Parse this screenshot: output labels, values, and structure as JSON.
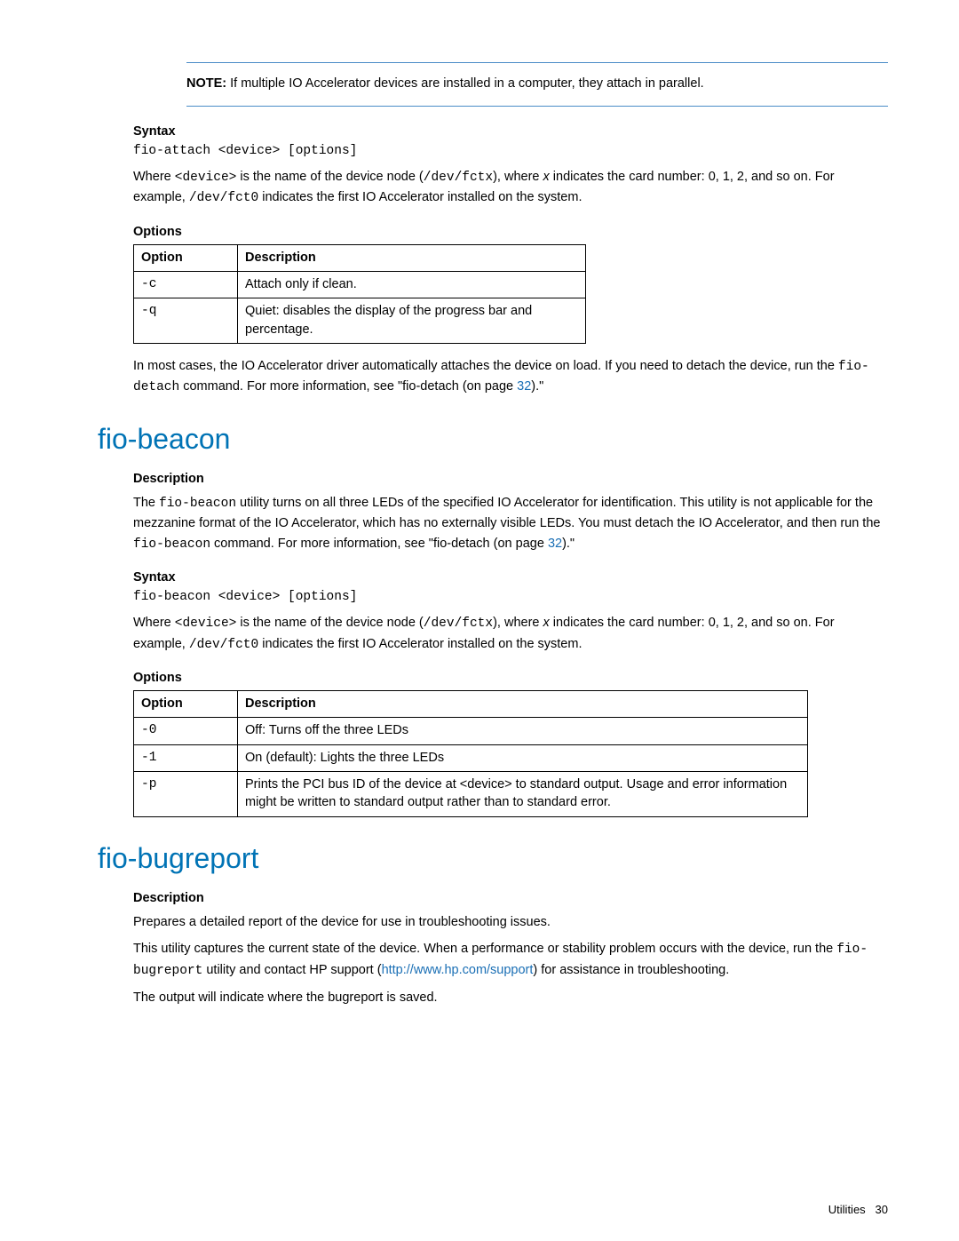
{
  "note": {
    "label": "NOTE:",
    "text": "If multiple IO Accelerator devices are installed in a computer, they attach in parallel."
  },
  "attach": {
    "syntax_heading": "Syntax",
    "syntax_code": "fio-attach <device> [options]",
    "where_1": "Where ",
    "where_device_mono": "<device>",
    "where_2": " is the name of the device node (",
    "where_devpath_mono": "/dev/fctx",
    "where_3": "), where ",
    "where_x": "x",
    "where_4": " indicates the card number: 0, 1, 2, and so on. For example, ",
    "where_fct0": "/dev/fct0",
    "where_5": " indicates the first IO Accelerator installed on the system.",
    "options_heading": "Options",
    "table": {
      "h1": "Option",
      "h2": "Description",
      "r1_opt": "-c",
      "r1_desc": "Attach only if clean.",
      "r2_opt": "-q",
      "r2_desc": "Quiet: disables the display of the progress bar and percentage."
    },
    "post_a": "In most cases, the IO Accelerator driver automatically attaches the device on load. If you need to detach the device, run the ",
    "post_cmd": "fio-detach",
    "post_b": " command. For more information, see \"fio-detach (on page ",
    "post_link": "32",
    "post_c": ").\""
  },
  "beacon": {
    "title": "fio-beacon",
    "desc_heading": "Description",
    "d1": "The ",
    "d1_cmd": "fio-beacon",
    "d2": " utility turns on all three LEDs of the specified IO Accelerator for identification. This utility is not applicable for the mezzanine format of the IO Accelerator, which has no externally visible LEDs. You must detach the IO Accelerator, and then run the ",
    "d2_cmd": "fio-beacon",
    "d3": " command. For more information, see \"fio-detach (on page ",
    "d3_link": "32",
    "d4": ").\"",
    "syntax_heading": "Syntax",
    "syntax_code": "fio-beacon <device> [options]",
    "where_1": "Where ",
    "where_device_mono": "<device>",
    "where_2": " is the name of the device node (",
    "where_devpath_mono": "/dev/fctx",
    "where_3": "), where ",
    "where_x": "x",
    "where_4": " indicates the card number: 0, 1, 2, and so on. For example, ",
    "where_fct0": "/dev/fct0",
    "where_5": " indicates the first IO Accelerator installed on the system.",
    "options_heading": "Options",
    "table": {
      "h1": "Option",
      "h2": "Description",
      "r1_opt": "-0",
      "r1_desc": "Off: Turns off the three LEDs",
      "r2_opt": "-1",
      "r2_desc": "On (default): Lights the three LEDs",
      "r3_opt": "-p",
      "r3_desc": "Prints the PCI bus ID of the device at <device> to standard output. Usage and error information might be written to standard output rather than to standard error."
    }
  },
  "bugreport": {
    "title": "fio-bugreport",
    "desc_heading": "Description",
    "p1": "Prepares a detailed report of the device for use in troubleshooting issues.",
    "p2a": "This utility captures the current state of the device. When a performance or stability problem occurs with the device, run the ",
    "p2cmd": "fio-bugreport",
    "p2b": " utility and contact HP support (",
    "p2link": "http://www.hp.com/support",
    "p2c": ") for assistance in troubleshooting.",
    "p3": "The output will indicate where the bugreport is saved."
  },
  "footer": {
    "section": "Utilities",
    "page": "30"
  }
}
